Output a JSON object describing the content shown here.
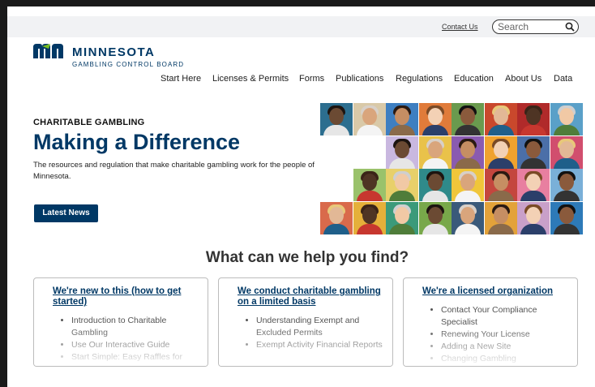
{
  "utility": {
    "contact_label": "Contact Us",
    "search_placeholder": "Search"
  },
  "logo": {
    "title": "MINNESOTA",
    "subtitle": "GAMBLING CONTROL BOARD",
    "brand_color": "#003865",
    "accent_color": "#78BE21"
  },
  "nav": {
    "items": [
      {
        "label": "Start Here"
      },
      {
        "label": "Licenses & Permits"
      },
      {
        "label": "Forms"
      },
      {
        "label": "Publications"
      },
      {
        "label": "Regulations"
      },
      {
        "label": "Education"
      },
      {
        "label": "About Us"
      },
      {
        "label": "Data"
      }
    ]
  },
  "hero": {
    "kicker": "CHARITABLE GAMBLING",
    "title": "Making a Difference",
    "description": "The resources and regulation that make charitable gambling work for the people of Minnesota.",
    "button_label": "Latest News",
    "photo_grid_icon": "people-photo-collage"
  },
  "help": {
    "heading": "What can we help you find?",
    "cards": [
      {
        "title": "We're new to this (how to get started)",
        "items": [
          "Introduction to Charitable Gambling",
          "Use Our Interactive Guide",
          "Start Simple: Easy Raffles for"
        ]
      },
      {
        "title": "We conduct charitable gambling on a limited basis",
        "items": [
          "Understanding Exempt and Excluded Permits",
          "Exempt Activity Financial Reports"
        ]
      },
      {
        "title": "We're a licensed organization",
        "items": [
          "Contact Your Compliance Specialist",
          "Renewing Your License",
          "Adding a New Site",
          "Changing Gambling"
        ]
      }
    ]
  }
}
